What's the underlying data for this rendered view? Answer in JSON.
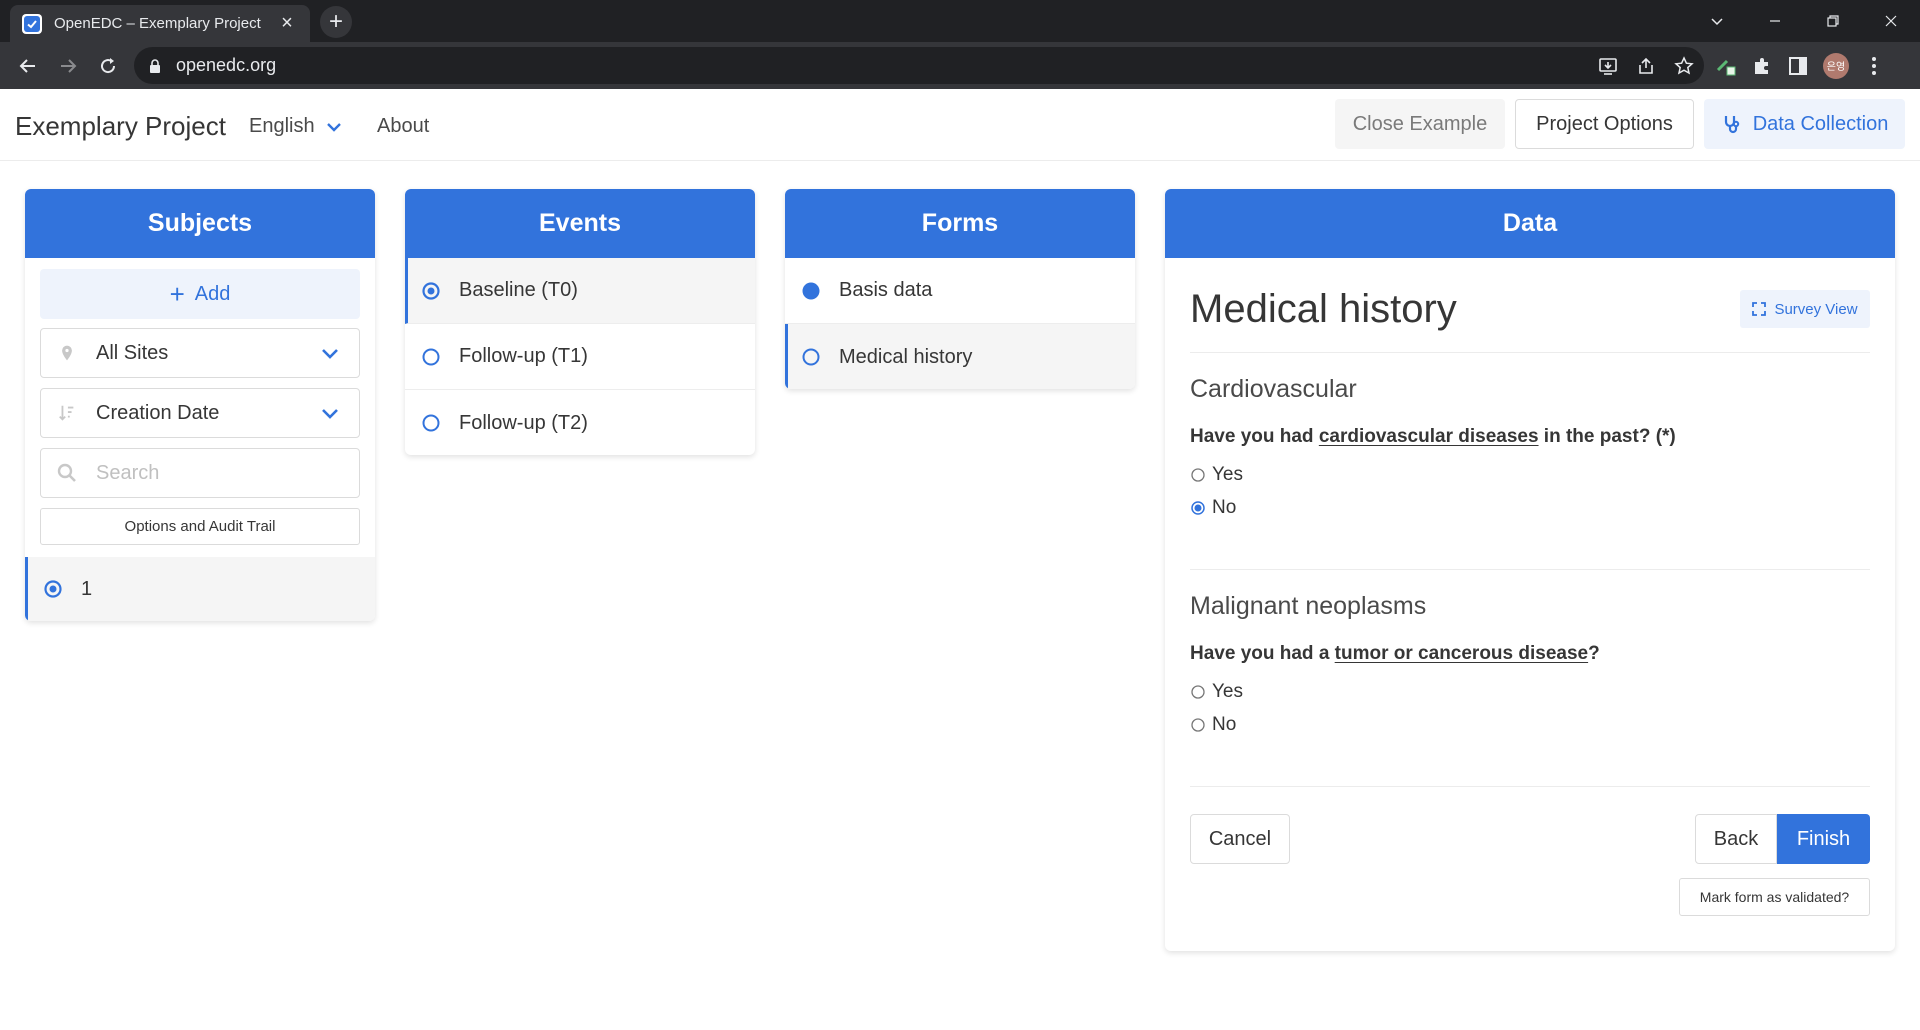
{
  "browser": {
    "tab_title": "OpenEDC – Exemplary Project",
    "url": "openedc.org",
    "profile_initials": "은영"
  },
  "header": {
    "project_name": "Exemplary Project",
    "language": "English",
    "about": "About",
    "close_example": "Close Example",
    "project_options": "Project Options",
    "data_collection": "Data Collection"
  },
  "subjects": {
    "title": "Subjects",
    "add_label": "Add",
    "site_filter": "All Sites",
    "sort_by": "Creation Date",
    "search_placeholder": "Search",
    "audit_label": "Options and Audit Trail",
    "items": [
      {
        "label": "1"
      }
    ]
  },
  "events": {
    "title": "Events",
    "items": [
      {
        "label": "Baseline (T0)",
        "state": "selected"
      },
      {
        "label": "Follow-up (T1)",
        "state": "empty"
      },
      {
        "label": "Follow-up (T2)",
        "state": "empty"
      }
    ]
  },
  "forms": {
    "title": "Forms",
    "items": [
      {
        "label": "Basis data",
        "state": "completed"
      },
      {
        "label": "Medical history",
        "state": "empty"
      }
    ]
  },
  "data": {
    "title": "Data",
    "form_title": "Medical history",
    "survey_view": "Survey View",
    "sections": [
      {
        "title": "Cardiovascular",
        "question_pre": "Have you had ",
        "question_link": "cardiovascular diseases",
        "question_post": " in the past? (*)",
        "options": [
          {
            "label": "Yes",
            "checked": false
          },
          {
            "label": "No",
            "checked": true
          }
        ]
      },
      {
        "title": "Malignant neoplasms",
        "question_pre": "Have you had a ",
        "question_link": "tumor or cancerous disease",
        "question_post": "?",
        "options": [
          {
            "label": "Yes",
            "checked": false
          },
          {
            "label": "No",
            "checked": false
          }
        ]
      }
    ],
    "cancel": "Cancel",
    "back": "Back",
    "finish": "Finish",
    "validate": "Mark form as validated?"
  },
  "colors": {
    "primary": "#3273dc",
    "primary_light": "#eef3fc",
    "chrome_dark": "#202124",
    "chrome_mid": "#35363a"
  }
}
